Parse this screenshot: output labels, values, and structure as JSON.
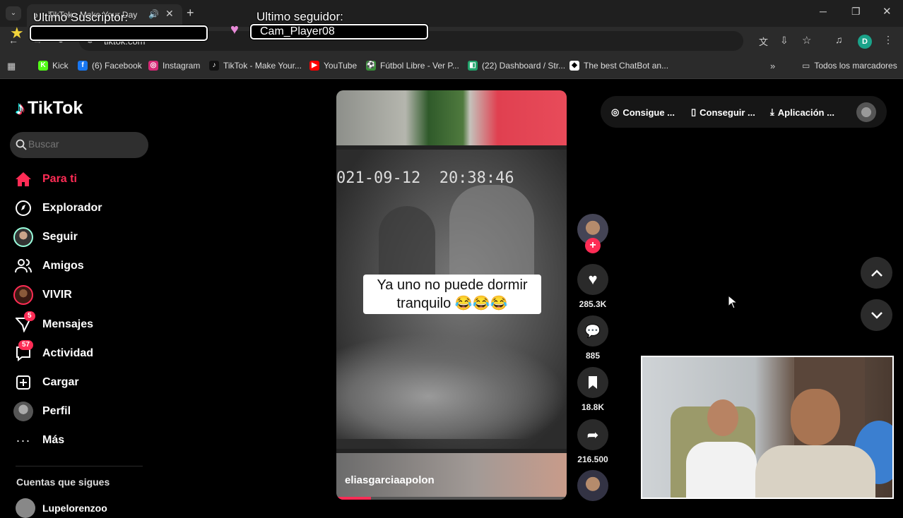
{
  "browser": {
    "tab_title": "TikTok - Make Your Day",
    "url": "tiktok.com",
    "profile_initial": "D",
    "bookmarks": [
      {
        "label": "Kick",
        "icon": "kick-icon",
        "color": "#53fc18",
        "glyph": "K"
      },
      {
        "label": "(6) Facebook",
        "icon": "facebook-icon",
        "color": "#1877f2",
        "glyph": "f"
      },
      {
        "label": "Instagram",
        "icon": "instagram-icon",
        "color": "#d62976",
        "glyph": "◎"
      },
      {
        "label": "TikTok - Make Your...",
        "icon": "tiktok-icon",
        "color": "#111111",
        "glyph": "♪"
      },
      {
        "label": "YouTube",
        "icon": "youtube-icon",
        "color": "#ff0000",
        "glyph": "▶"
      },
      {
        "label": "Fútbol Libre - Ver P...",
        "icon": "football-icon",
        "color": "#3a8f3a",
        "glyph": "⚽"
      },
      {
        "label": "(22) Dashboard / Str...",
        "icon": "dashboard-icon",
        "color": "#22a36b",
        "glyph": "◧"
      },
      {
        "label": "The best ChatBot an...",
        "icon": "chatbot-icon",
        "color": "#ffffff",
        "glyph": "◆"
      }
    ],
    "all_bookmarks_label": "Todos los marcadores"
  },
  "overlay": {
    "subscriber_label": "Ultimo Suscriptor:",
    "subscriber_value": "",
    "follower_label": "Ultimo seguidor:",
    "follower_value": "Cam_Player08"
  },
  "tiktok": {
    "logo_text": "TikTok",
    "search_placeholder": "Buscar",
    "nav": [
      {
        "label": "Para ti",
        "icon": "home-icon",
        "active": true
      },
      {
        "label": "Explorador",
        "icon": "compass-icon"
      },
      {
        "label": "Seguir",
        "icon": "following-avatar-icon"
      },
      {
        "label": "Amigos",
        "icon": "friends-icon"
      },
      {
        "label": "VIVIR",
        "icon": "live-icon"
      },
      {
        "label": "Mensajes",
        "icon": "messages-icon",
        "badge": "5"
      },
      {
        "label": "Actividad",
        "icon": "activity-icon",
        "badge": "57"
      },
      {
        "label": "Cargar",
        "icon": "upload-icon"
      },
      {
        "label": "Perfil",
        "icon": "profile-icon"
      },
      {
        "label": "Más",
        "icon": "more-icon"
      }
    ],
    "following_heading": "Cuentas que sigues",
    "following_first": "Lupelorenzoo",
    "top_actions": [
      "Consigue ...",
      "Conseguir ...",
      "Aplicación ..."
    ],
    "video": {
      "timestamp_overlay": "021-09-12  20:38:46",
      "caption_line1": "Ya uno no puede dormir",
      "caption_line2": "tranquilo 😂😂😂",
      "username": "eliasgarciaapolon",
      "likes": "285.3K",
      "comments": "885",
      "saves": "18.8K",
      "shares": "216.500"
    },
    "colors": {
      "accent": "#fe2c55",
      "bg": "#000000",
      "surface": "#2f2f2f"
    }
  }
}
